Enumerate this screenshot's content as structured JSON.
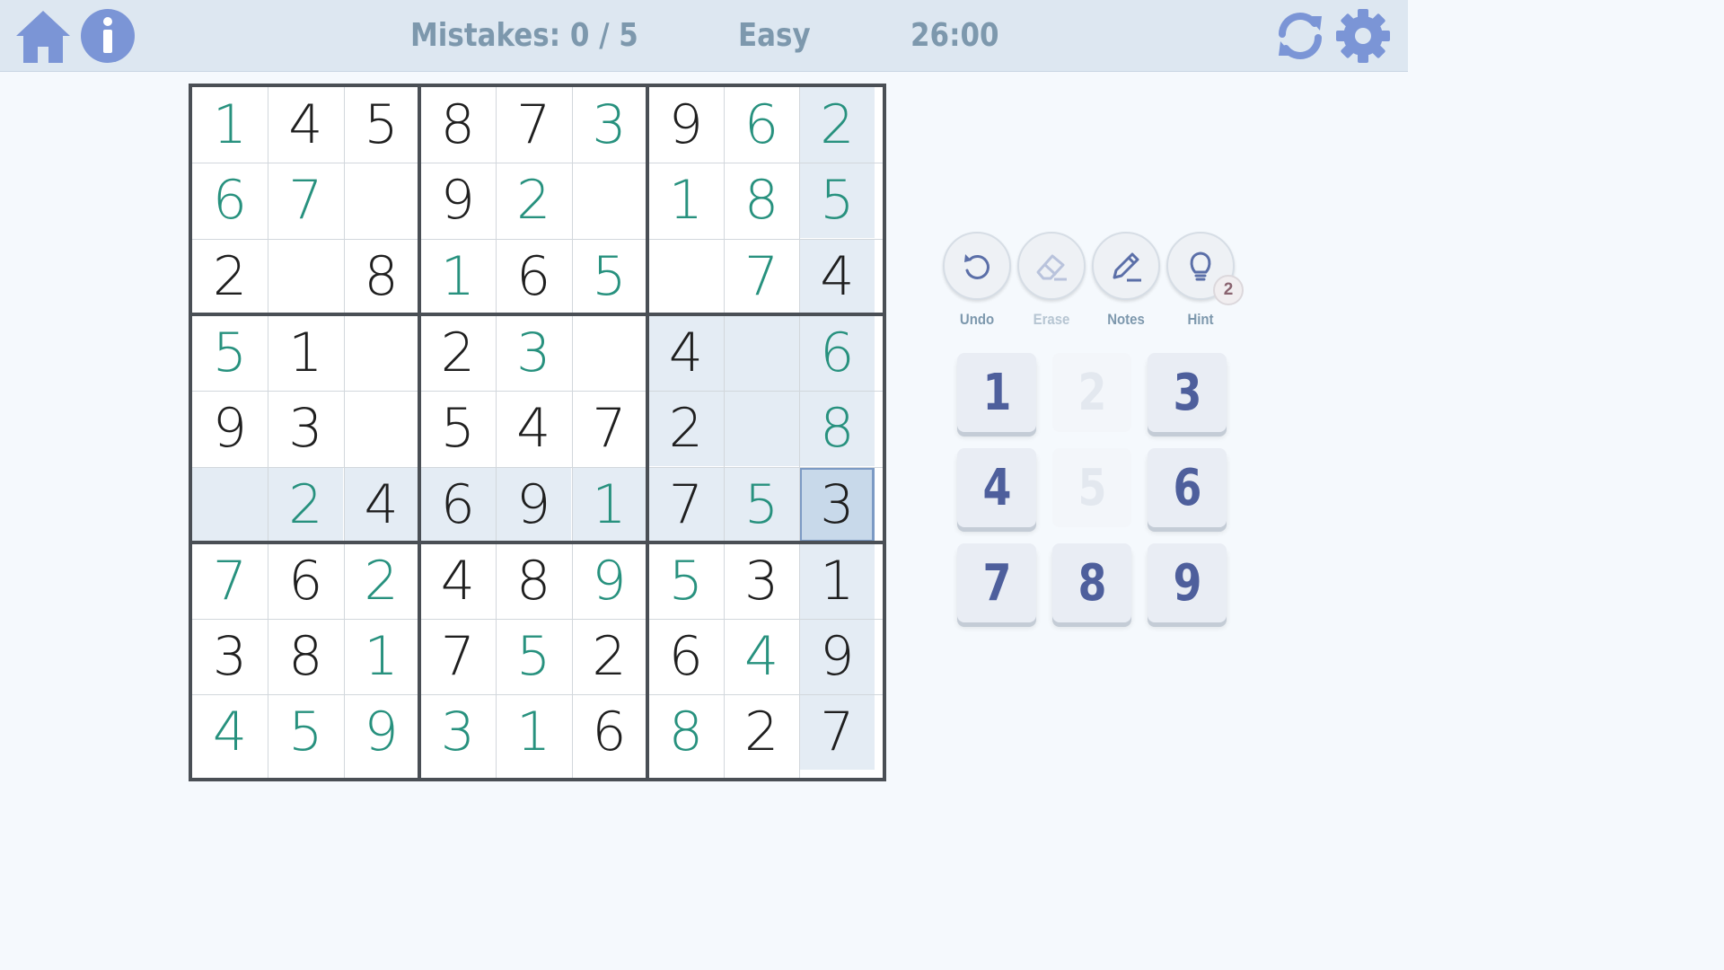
{
  "header": {
    "home_icon": "home-icon",
    "info_icon": "info-icon",
    "mistakes": "Mistakes: 0 / 5",
    "difficulty": "Easy",
    "timer": "26:00",
    "restart_icon": "restart-icon",
    "settings_icon": "gear-icon"
  },
  "colors": {
    "accent": "#7b95d6",
    "given_digit": "#1f1f1f",
    "entered_digit": "#27917e",
    "highlight": "#e4ecf4",
    "selected": "#c8d9ea"
  },
  "board": {
    "rows": [
      [
        "1",
        "4",
        "5",
        "8",
        "7",
        "3",
        "9",
        "6",
        "2"
      ],
      [
        "6",
        "7",
        "",
        "9",
        "2",
        "",
        "1",
        "8",
        "5"
      ],
      [
        "2",
        "",
        "8",
        "1",
        "6",
        "5",
        "",
        "7",
        "4"
      ],
      [
        "5",
        "1",
        "",
        "2",
        "3",
        "",
        "4",
        "",
        "6"
      ],
      [
        "9",
        "3",
        "",
        "5",
        "4",
        "7",
        "2",
        "",
        "8"
      ],
      [
        "",
        "2",
        "4",
        "6",
        "9",
        "1",
        "7",
        "5",
        "3"
      ],
      [
        "7",
        "6",
        "2",
        "4",
        "8",
        "9",
        "5",
        "3",
        "1"
      ],
      [
        "3",
        "8",
        "1",
        "7",
        "5",
        "2",
        "6",
        "4",
        "9"
      ],
      [
        "4",
        "5",
        "9",
        "3",
        "1",
        "6",
        "8",
        "2",
        "7"
      ]
    ],
    "entered": [
      [
        1,
        0,
        0,
        0,
        0,
        1,
        0,
        1,
        1
      ],
      [
        1,
        1,
        0,
        0,
        1,
        0,
        1,
        1,
        1
      ],
      [
        0,
        0,
        0,
        1,
        0,
        1,
        0,
        1,
        0
      ],
      [
        1,
        0,
        0,
        0,
        1,
        0,
        0,
        0,
        1
      ],
      [
        0,
        0,
        0,
        0,
        0,
        0,
        0,
        0,
        1
      ],
      [
        0,
        1,
        0,
        0,
        0,
        1,
        0,
        1,
        0
      ],
      [
        1,
        0,
        1,
        0,
        0,
        1,
        1,
        0,
        0
      ],
      [
        0,
        0,
        1,
        0,
        1,
        0,
        0,
        1,
        0
      ],
      [
        1,
        1,
        1,
        1,
        1,
        0,
        1,
        0,
        0
      ]
    ],
    "selected": {
      "row": 5,
      "col": 8
    }
  },
  "tools": [
    {
      "label": "Undo",
      "icon": "undo-icon",
      "enabled": true
    },
    {
      "label": "Erase",
      "icon": "eraser-icon",
      "enabled": false
    },
    {
      "label": "Notes",
      "icon": "pencil-icon",
      "enabled": true
    },
    {
      "label": "Hint",
      "icon": "lightbulb-icon",
      "enabled": true,
      "badge": "2"
    }
  ],
  "keypad": [
    {
      "digit": "1",
      "available": true
    },
    {
      "digit": "2",
      "available": false
    },
    {
      "digit": "3",
      "available": true
    },
    {
      "digit": "4",
      "available": true
    },
    {
      "digit": "5",
      "available": false
    },
    {
      "digit": "6",
      "available": true
    },
    {
      "digit": "7",
      "available": true
    },
    {
      "digit": "8",
      "available": true
    },
    {
      "digit": "9",
      "available": true
    }
  ]
}
